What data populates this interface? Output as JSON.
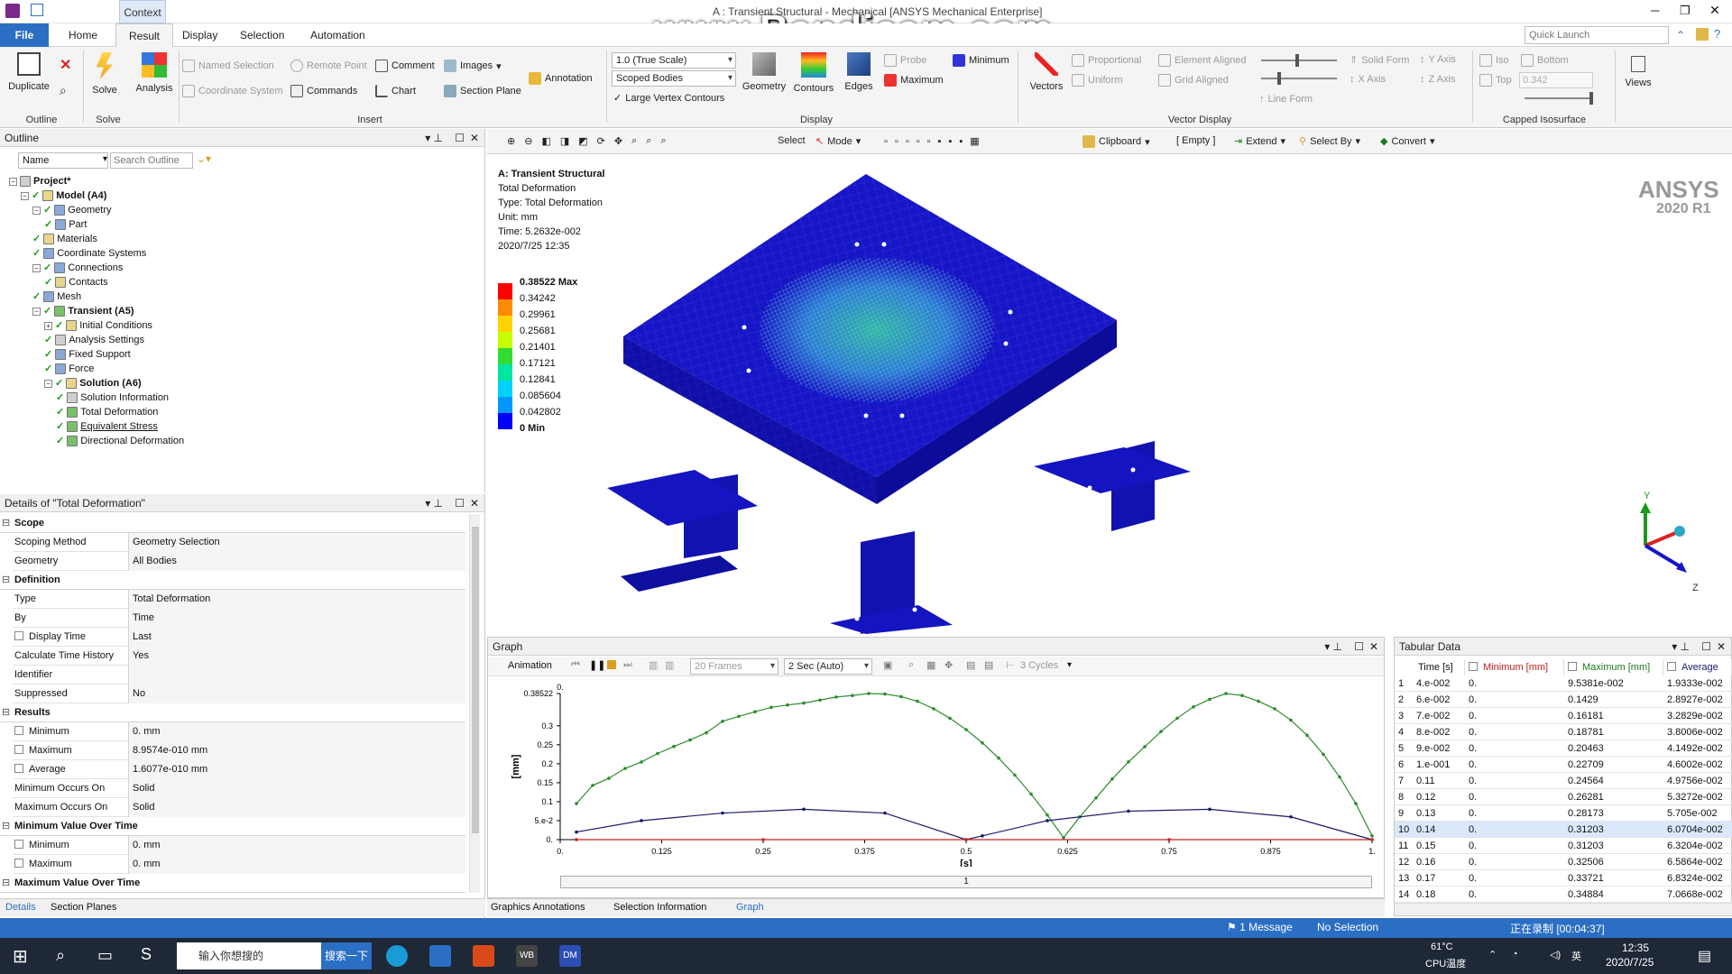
{
  "window": {
    "context_tab": "Context",
    "title": "A : Transient Structural - Mechanical [ANSYS Mechanical Enterprise]",
    "watermark": "www.Bandicam.com",
    "controls": [
      "─",
      "❐",
      "✕"
    ]
  },
  "menu_tabs": [
    "File",
    "Home",
    "Result",
    "Display",
    "Selection",
    "Automation"
  ],
  "quick_launch_placeholder": "Quick Launch",
  "ribbon": {
    "outline": {
      "duplicate": "Duplicate",
      "label": "Outline"
    },
    "solve": {
      "solve": "Solve",
      "analysis": "Analysis",
      "label": "Solve"
    },
    "insert": {
      "named_selection": "Named Selection",
      "remote_point": "Remote Point",
      "comment": "Comment",
      "images": "Images",
      "coordinate_system": "Coordinate System",
      "commands": "Commands",
      "chart": "Chart",
      "section_plane": "Section Plane",
      "annotation": "Annotation",
      "label": "Insert"
    },
    "display": {
      "scale": "1.0 (True Scale)",
      "scoped_bodies": "Scoped Bodies",
      "large_vertex": "Large Vertex Contours",
      "geometry": "Geometry",
      "contours": "Contours",
      "edges": "Edges",
      "probe": "Probe",
      "maximum": "Maximum",
      "minimum": "Minimum",
      "label": "Display"
    },
    "vector_display": {
      "vectors": "Vectors",
      "proportional": "Proportional",
      "uniform": "Uniform",
      "element_aligned": "Element Aligned",
      "grid_aligned": "Grid Aligned",
      "line_form": "Line Form",
      "solid_form": "Solid Form",
      "y_axis": "Y Axis",
      "x_axis": "X Axis",
      "z_axis": "Z Axis",
      "label": "Vector Display"
    },
    "capped": {
      "iso": "Iso",
      "bottom": "Bottom",
      "top": "Top",
      "top_value": "0.342",
      "label": "Capped Isosurface"
    },
    "views": "Views"
  },
  "outline": {
    "title": "Outline",
    "name_filter": "Name",
    "search_placeholder": "Search Outline",
    "tree": [
      {
        "label": "Project*",
        "level": 0,
        "bold": true,
        "icon": "gray"
      },
      {
        "label": "Model (A4)",
        "level": 1,
        "bold": true,
        "icon": "yellow"
      },
      {
        "label": "Geometry",
        "level": 2,
        "bold": false,
        "icon": "blue"
      },
      {
        "label": "Part",
        "level": 3,
        "bold": false,
        "icon": "blue"
      },
      {
        "label": "Materials",
        "level": 2,
        "bold": false,
        "icon": "yellow"
      },
      {
        "label": "Coordinate Systems",
        "level": 2,
        "bold": false,
        "icon": "blue"
      },
      {
        "label": "Connections",
        "level": 2,
        "bold": false,
        "icon": "blue"
      },
      {
        "label": "Contacts",
        "level": 3,
        "bold": false,
        "icon": "yellow"
      },
      {
        "label": "Mesh",
        "level": 2,
        "bold": false,
        "icon": "blue"
      },
      {
        "label": "Transient (A5)",
        "level": 2,
        "bold": true,
        "icon": "green"
      },
      {
        "label": "Initial Conditions",
        "level": 3,
        "bold": false,
        "icon": "yellow"
      },
      {
        "label": "Analysis Settings",
        "level": 3,
        "bold": false,
        "icon": "gray"
      },
      {
        "label": "Fixed Support",
        "level": 3,
        "bold": false,
        "icon": "blue"
      },
      {
        "label": "Force",
        "level": 3,
        "bold": false,
        "icon": "blue"
      },
      {
        "label": "Solution (A6)",
        "level": 3,
        "bold": true,
        "icon": "yellow"
      },
      {
        "label": "Solution Information",
        "level": 4,
        "bold": false,
        "icon": "gray"
      },
      {
        "label": "Total Deformation",
        "level": 4,
        "bold": false,
        "icon": "green"
      },
      {
        "label": "Equivalent Stress",
        "level": 4,
        "bold": false,
        "icon": "green"
      },
      {
        "label": "Directional Deformation",
        "level": 4,
        "bold": false,
        "icon": "green"
      }
    ]
  },
  "details": {
    "title": "Details of \"Total Deformation\"",
    "sections": [
      {
        "name": "Scope",
        "rows": [
          {
            "k": "Scoping Method",
            "v": "Geometry Selection"
          },
          {
            "k": "Geometry",
            "v": "All Bodies"
          }
        ]
      },
      {
        "name": "Definition",
        "rows": [
          {
            "k": "Type",
            "v": "Total Deformation"
          },
          {
            "k": "By",
            "v": "Time"
          },
          {
            "k": "Display Time",
            "v": "Last",
            "cb": true
          },
          {
            "k": "Calculate Time History",
            "v": "Yes"
          },
          {
            "k": "Identifier",
            "v": ""
          },
          {
            "k": "Suppressed",
            "v": "No"
          }
        ]
      },
      {
        "name": "Results",
        "rows": [
          {
            "k": "Minimum",
            "v": "0. mm",
            "cb": true
          },
          {
            "k": "Maximum",
            "v": "8.9574e-010 mm",
            "cb": true
          },
          {
            "k": "Average",
            "v": "1.6077e-010 mm",
            "cb": true
          },
          {
            "k": "Minimum Occurs On",
            "v": "Solid"
          },
          {
            "k": "Maximum Occurs On",
            "v": "Solid"
          }
        ]
      },
      {
        "name": "Minimum Value Over Time",
        "rows": [
          {
            "k": "Minimum",
            "v": "0. mm",
            "cb": true
          },
          {
            "k": "Maximum",
            "v": "0. mm",
            "cb": true
          }
        ]
      },
      {
        "name": "Maximum Value Over Time",
        "rows": []
      }
    ],
    "tabs": [
      "Details",
      "Section Planes"
    ]
  },
  "viewport": {
    "toolbar": {
      "select": "Select",
      "mode": "Mode",
      "clipboard": "Clipboard",
      "empty": "[ Empty ]",
      "extend": "Extend",
      "select_by": "Select By",
      "convert": "Convert"
    },
    "info": [
      "A: Transient Structural",
      "Total Deformation",
      "Type: Total Deformation",
      "Unit: mm",
      "Time: 5.2632e-002",
      "2020/7/25 12:35"
    ],
    "legend": {
      "max_label": "0.38522 Max",
      "values": [
        "0.34242",
        "0.29961",
        "0.25681",
        "0.21401",
        "0.17121",
        "0.12841",
        "0.085604",
        "0.042802"
      ],
      "min_label": "0 Min",
      "colors": [
        "#ff0000",
        "#ff8c00",
        "#ffd200",
        "#c8ff00",
        "#32dc32",
        "#00e6a0",
        "#00d2ff",
        "#0096ff",
        "#0000ff"
      ]
    },
    "brand": "ANSYS",
    "version": "2020 R1",
    "triad": {
      "x": "X",
      "y": "Y",
      "z": "Z"
    }
  },
  "graph": {
    "title": "Graph",
    "animation": "Animation",
    "frames": "20 Frames",
    "duration": "2 Sec (Auto)",
    "cycles": "3 Cycles",
    "slider_value": "1",
    "bottom_tabs": [
      "Graphics Annotations",
      "Selection Information",
      "Graph"
    ]
  },
  "chart_data": {
    "type": "line",
    "xlabel": "[s]",
    "ylabel": "[mm]",
    "x_ticks": [
      "0.",
      "0.125",
      "0.25",
      "0.375",
      "0.5",
      "0.625",
      "0.75",
      "0.875",
      "1."
    ],
    "y_ticks": [
      "0.",
      "5.e-2",
      "0.1",
      "0.15",
      "0.2",
      "0.25",
      "0.3",
      "0.38522"
    ],
    "top_tick": "0.",
    "xlim": [
      0,
      1
    ],
    "ylim": [
      0,
      0.38522
    ],
    "grid": false,
    "series": [
      {
        "color": "#2e8b2e",
        "x": [
          0.02,
          0.04,
          0.06,
          0.08,
          0.1,
          0.12,
          0.14,
          0.16,
          0.18,
          0.2,
          0.22,
          0.24,
          0.26,
          0.28,
          0.3,
          0.32,
          0.34,
          0.36,
          0.38,
          0.4,
          0.42,
          0.44,
          0.46,
          0.48,
          0.5,
          0.52,
          0.54,
          0.56,
          0.58,
          0.6,
          0.62,
          0.64,
          0.66,
          0.68,
          0.7,
          0.72,
          0.74,
          0.76,
          0.78,
          0.8,
          0.82,
          0.84,
          0.86,
          0.88,
          0.9,
          0.92,
          0.94,
          0.96,
          0.98,
          1.0
        ],
        "values": [
          0.095,
          0.1429,
          0.1618,
          0.1878,
          0.2046,
          0.2271,
          0.2456,
          0.2628,
          0.2817,
          0.312,
          0.3251,
          0.3372,
          0.3488,
          0.355,
          0.36,
          0.368,
          0.376,
          0.38,
          0.3852,
          0.384,
          0.377,
          0.365,
          0.345,
          0.32,
          0.29,
          0.255,
          0.215,
          0.17,
          0.12,
          0.065,
          0.005,
          0.06,
          0.11,
          0.16,
          0.205,
          0.245,
          0.285,
          0.32,
          0.35,
          0.37,
          0.3852,
          0.38,
          0.365,
          0.345,
          0.315,
          0.275,
          0.225,
          0.165,
          0.095,
          0.01
        ]
      },
      {
        "color": "#1a1a6a",
        "x": [
          0.02,
          0.1,
          0.2,
          0.3,
          0.4,
          0.5,
          0.52,
          0.6,
          0.7,
          0.8,
          0.9,
          1.0
        ],
        "values": [
          0.02,
          0.05,
          0.07,
          0.08,
          0.07,
          0.0,
          0.01,
          0.05,
          0.075,
          0.08,
          0.06,
          0.0
        ]
      },
      {
        "color": "#cc2020",
        "x": [
          0.02,
          0.25,
          0.5,
          0.75,
          1.0
        ],
        "values": [
          0,
          0,
          0,
          0,
          0
        ]
      }
    ]
  },
  "tabular": {
    "title": "Tabular Data",
    "headers": [
      "Time [s]",
      "Minimum [mm]",
      "Maximum [mm]",
      "Average"
    ],
    "rows": [
      [
        "1",
        "4.e-002",
        "0.",
        "9.5381e-002",
        "1.9333e-002"
      ],
      [
        "2",
        "6.e-002",
        "0.",
        "0.1429",
        "2.8927e-002"
      ],
      [
        "3",
        "7.e-002",
        "0.",
        "0.16181",
        "3.2829e-002"
      ],
      [
        "4",
        "8.e-002",
        "0.",
        "0.18781",
        "3.8006e-002"
      ],
      [
        "5",
        "9.e-002",
        "0.",
        "0.20463",
        "4.1492e-002"
      ],
      [
        "6",
        "1.e-001",
        "0.",
        "0.22709",
        "4.6002e-002"
      ],
      [
        "7",
        "0.11",
        "0.",
        "0.24564",
        "4.9756e-002"
      ],
      [
        "8",
        "0.12",
        "0.",
        "0.26281",
        "5.3272e-002"
      ],
      [
        "9",
        "0.13",
        "0.",
        "0.28173",
        "5.705e-002"
      ],
      [
        "10",
        "0.14",
        "0.",
        "0.31203",
        "6.0704e-002"
      ],
      [
        "11",
        "0.15",
        "0.",
        "0.31203",
        "6.3204e-002"
      ],
      [
        "12",
        "0.16",
        "0.",
        "0.32506",
        "6.5864e-002"
      ],
      [
        "13",
        "0.17",
        "0.",
        "0.33721",
        "6.8324e-002"
      ],
      [
        "14",
        "0.18",
        "0.",
        "0.34884",
        "7.0668e-002"
      ]
    ]
  },
  "status": {
    "message": "1 Message",
    "selection": "No Selection",
    "recording": "正在录制 [00:04:37]"
  },
  "taskbar": {
    "search_placeholder": "输入你想搜的",
    "search_button": "搜索一下",
    "apps": [
      "WB",
      "DM"
    ],
    "temp": "61°C",
    "cpu_label": "CPU温度",
    "ime": "英",
    "time": "12:35",
    "date": "2020/7/25"
  }
}
